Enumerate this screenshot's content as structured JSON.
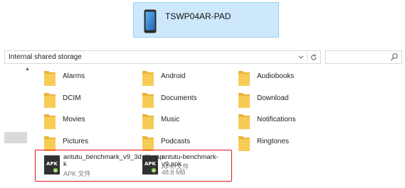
{
  "device": {
    "name": "TSWP04AR-PAD",
    "icon": "tablet-icon"
  },
  "address_bar": {
    "path": "Internal shared storage"
  },
  "search": {
    "placeholder": "",
    "icon": "search-icon"
  },
  "folders": [
    {
      "name": "Alarms"
    },
    {
      "name": "Android"
    },
    {
      "name": "Audiobooks"
    },
    {
      "name": "DCIM"
    },
    {
      "name": "Documents"
    },
    {
      "name": "Download"
    },
    {
      "name": "Movies"
    },
    {
      "name": "Music"
    },
    {
      "name": "Notifications"
    },
    {
      "name": "Pictures"
    },
    {
      "name": "Podcasts"
    },
    {
      "name": "Ringtones"
    }
  ],
  "files": [
    {
      "name_line1": "antutu_benchmark_v9_3d_lite.ap",
      "name_line2": "k",
      "type": "APK 文件",
      "size": ""
    },
    {
      "name_line1": "antutu-benchmark-v9.apk",
      "name_line2": "",
      "type": "APK 文件",
      "size": "48.8 MB"
    }
  ],
  "colors": {
    "selection_outline": "#e0141e",
    "device_tile": "#cde8fb",
    "folder": "#f7cc55"
  }
}
